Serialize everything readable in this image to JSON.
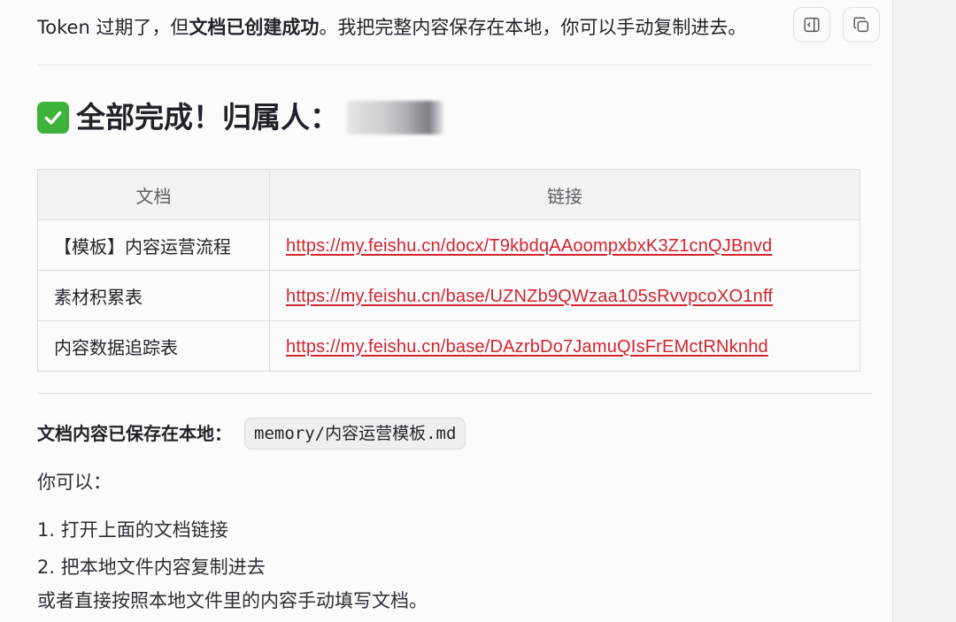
{
  "message": {
    "intro_plain_1": "Token 过期了，但",
    "intro_bold": "文档已创建成功",
    "intro_plain_2": "。我把完整内容保存在本地，你可以手动复制进去。",
    "heading_text": "全部完成！归属人：",
    "table": {
      "headers": [
        "文档",
        "链接"
      ],
      "rows": [
        {
          "name": "【模板】内容运营流程",
          "link": "https://my.feishu.cn/docx/T9kbdqAAoompxbxK3Z1cnQJBnvd"
        },
        {
          "name": "素材积累表",
          "link": "https://my.feishu.cn/base/UZNZb9QWzaa105sRvvpcoXO1nff"
        },
        {
          "name": "内容数据追踪表",
          "link": "https://my.feishu.cn/base/DAzrbDo7JamuQIsFrEMctRNknhd"
        }
      ]
    },
    "saved_label": "文档内容已保存在本地：",
    "saved_path": "memory/内容运营模板.md",
    "you_can": "你可以：",
    "step1": "1. 打开上面的文档链接",
    "step2": "2. 把本地文件内容复制进去",
    "closing": "或者直接按照本地文件里的内容手动填写文档。"
  },
  "icons": {
    "sidebar": "sidebar-panel-icon",
    "copy": "copy-icon",
    "check": "check-mark-icon"
  },
  "colors": {
    "link": "#d4242d",
    "check_bg": "#3eb33b"
  }
}
